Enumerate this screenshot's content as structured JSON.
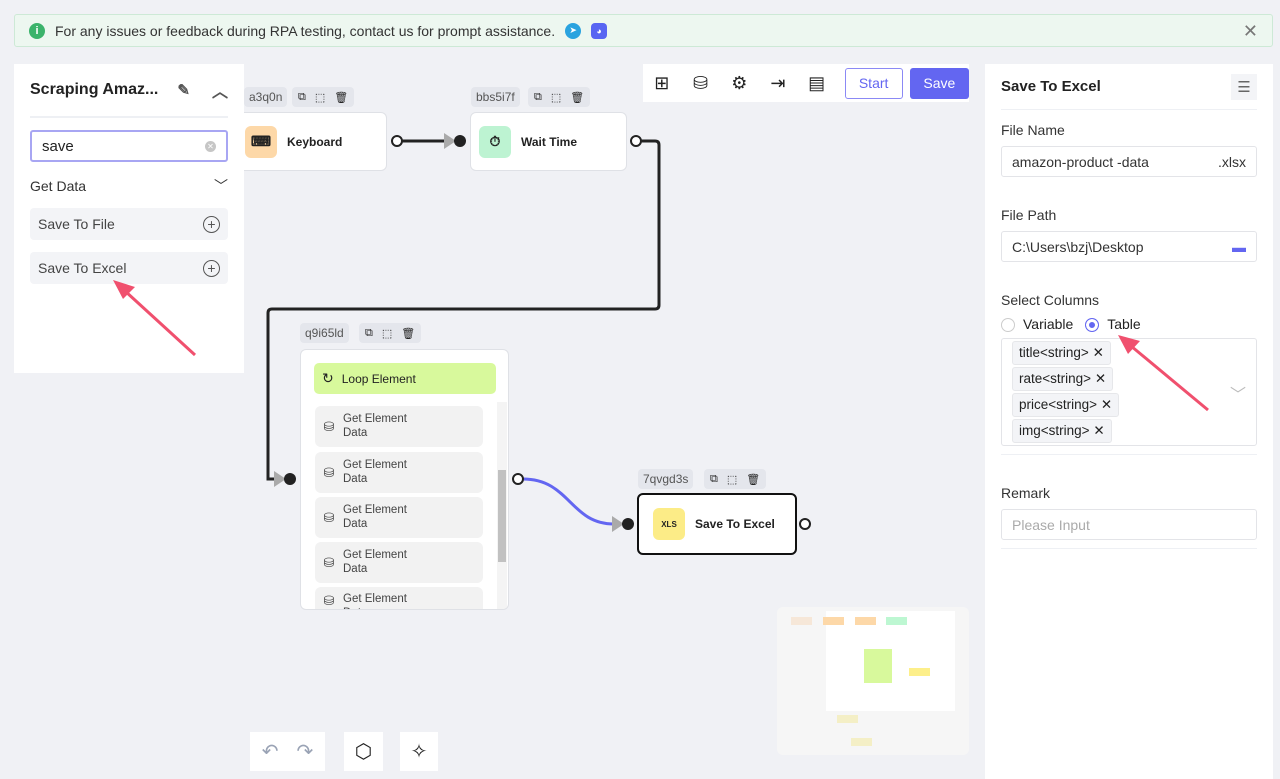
{
  "banner": {
    "text": "For any issues or feedback during RPA testing, contact us for prompt assistance.",
    "icons": [
      "info-icon",
      "telegram-icon",
      "discord-icon",
      "close-icon"
    ]
  },
  "left_panel": {
    "title": "Scraping Amaz...",
    "search_value": "save",
    "section": "Get Data",
    "items": [
      {
        "label": "Save To File"
      },
      {
        "label": "Save To Excel"
      }
    ]
  },
  "toolbar": {
    "icons": [
      "table-icon",
      "database-icon",
      "settings-icon",
      "export-icon",
      "log-icon"
    ],
    "start_label": "Start",
    "save_label": "Save"
  },
  "nodes": {
    "keyboard": {
      "id": "a3q0n",
      "label": "Keyboard"
    },
    "wait": {
      "id": "bbs5i7f",
      "label": "Wait Time"
    },
    "loop": {
      "id": "q9i65ld",
      "label": "Loop Element",
      "children": [
        "Get Element Data",
        "Get Element Data",
        "Get Element Data",
        "Get Element Data",
        "Get Element Data"
      ]
    },
    "excel": {
      "id": "7qvgd3s",
      "label": "Save To Excel",
      "icon_text": "XLS"
    }
  },
  "right_panel": {
    "title": "Save To Excel",
    "file_name_label": "File Name",
    "file_name": "amazon-product -data",
    "file_ext": ".xlsx",
    "file_path_label": "File Path",
    "file_path": "C:\\Users\\bzj\\Desktop",
    "select_columns_label": "Select Columns",
    "radio_variable": "Variable",
    "radio_table": "Table",
    "selected_radio": "Table",
    "columns": [
      "title<string>",
      "rate<string>",
      "price<string>",
      "img<string>"
    ],
    "remark_label": "Remark",
    "remark_placeholder": "Please Input"
  },
  "colors": {
    "accent": "#6366f1",
    "edge_active": "#6366f1",
    "annotation_arrow": "#f0506e"
  }
}
